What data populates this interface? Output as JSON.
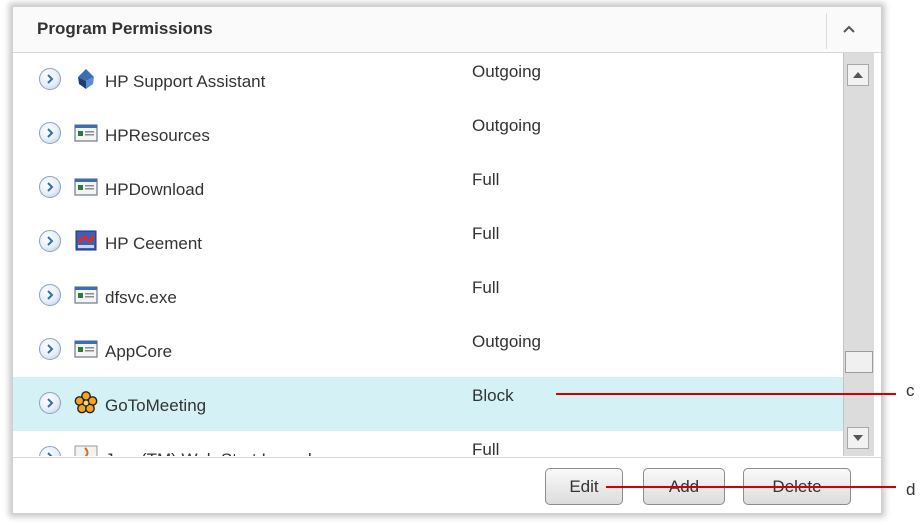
{
  "header": {
    "title": "Program Permissions"
  },
  "programs": [
    {
      "name": "HP Support Assistant",
      "permission": "Outgoing",
      "icon": "hp-support-assistant-icon",
      "selected": false
    },
    {
      "name": "HPResources",
      "permission": "Outgoing",
      "icon": "generic-app-icon",
      "selected": false
    },
    {
      "name": "HPDownload",
      "permission": "Full",
      "icon": "generic-app-icon",
      "selected": false
    },
    {
      "name": "HP Ceement",
      "permission": "Full",
      "icon": "hp-ceement-icon",
      "selected": false
    },
    {
      "name": "dfsvc.exe",
      "permission": "Full",
      "icon": "generic-app-icon",
      "selected": false
    },
    {
      "name": "AppCore",
      "permission": "Outgoing",
      "icon": "generic-app-icon",
      "selected": false
    },
    {
      "name": "GoToMeeting",
      "permission": "Block",
      "icon": "gotomeeting-icon",
      "selected": true
    },
    {
      "name": "Java(TM) Web Start Launcher",
      "permission": "Full",
      "icon": "java-icon",
      "selected": false
    }
  ],
  "buttons": {
    "edit": "Edit",
    "add": "Add",
    "delete": "Delete"
  },
  "callouts": {
    "c": "c",
    "d": "d"
  },
  "colors": {
    "selected_row": "#d4f2f6",
    "callout_line": "#d40000",
    "expand_arrow": "#2f6fb5"
  }
}
